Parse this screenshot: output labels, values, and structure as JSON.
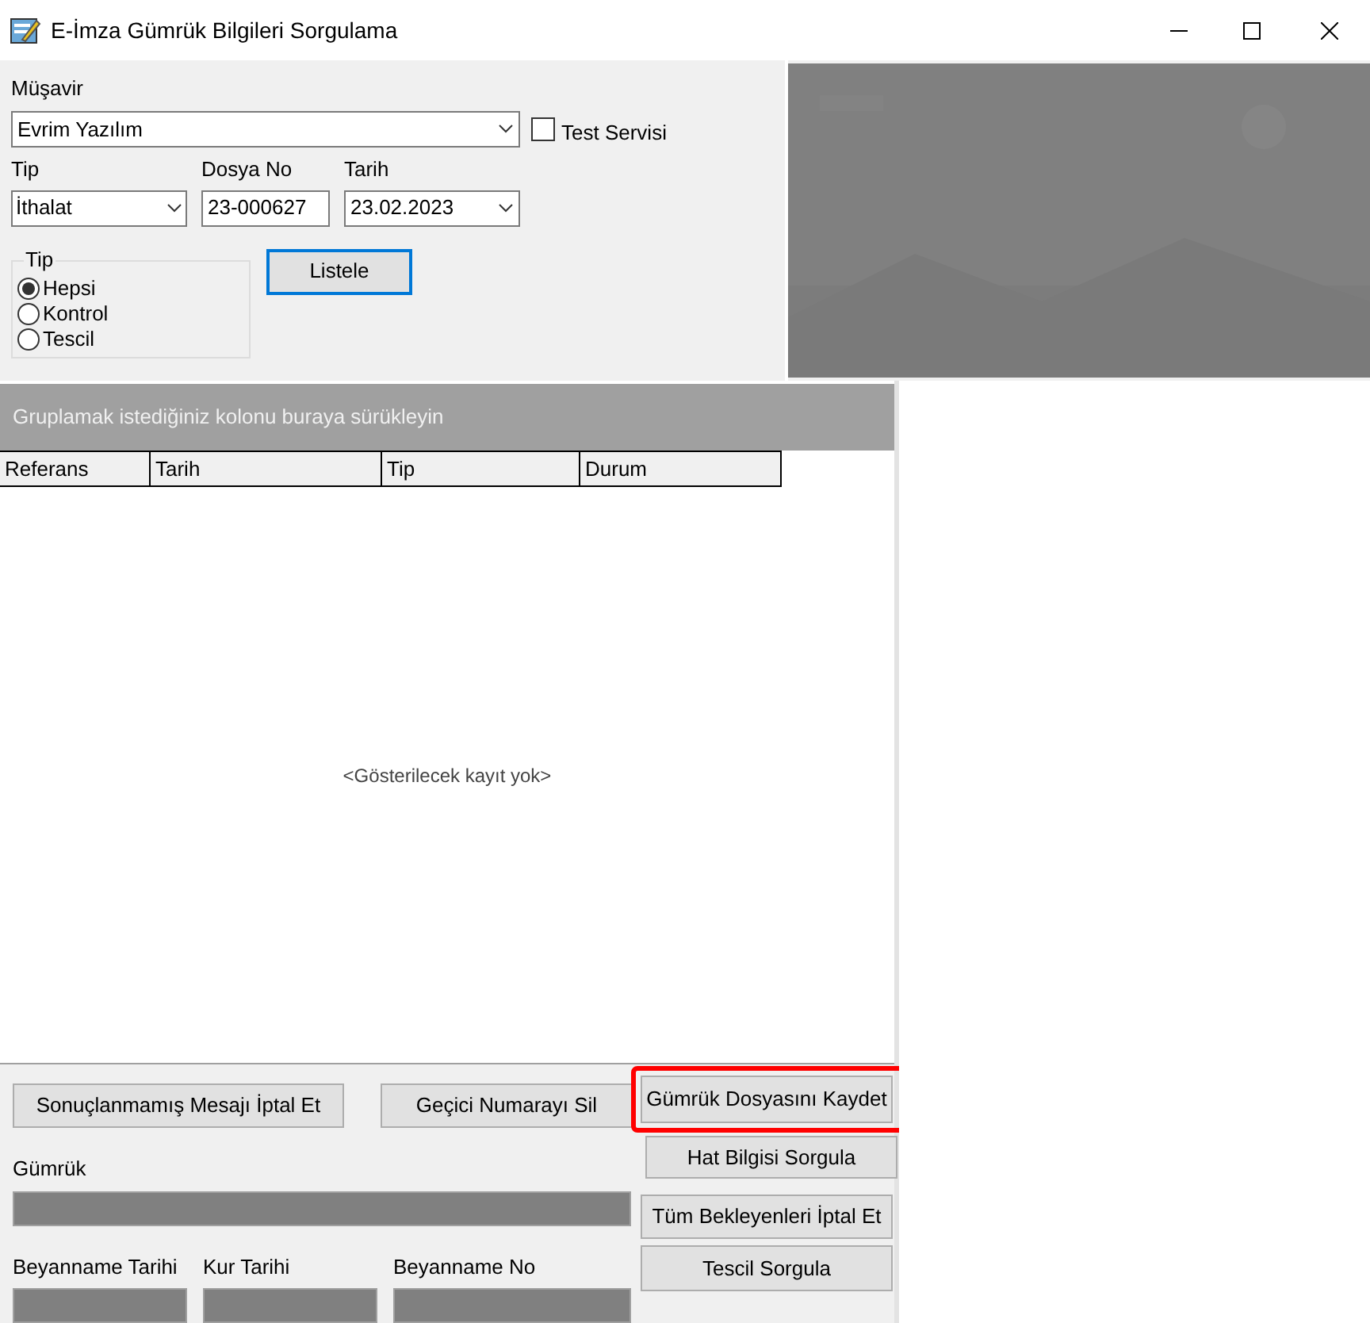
{
  "window": {
    "title": "E-İmza Gümrük Bilgileri Sorgulama"
  },
  "form": {
    "musavir": {
      "label": "Müşavir",
      "value": "Evrim Yazılım"
    },
    "test_servisi": {
      "label": "Test Servisi",
      "checked": false
    },
    "tip": {
      "label": "Tip",
      "value": "İthalat"
    },
    "dosya_no": {
      "label": "Dosya No",
      "value": "23-000627"
    },
    "tarih": {
      "label": "Tarih",
      "value": "23.02.2023"
    },
    "radio_group": {
      "label": "Tip",
      "options": [
        {
          "label": "Hepsi",
          "selected": true
        },
        {
          "label": "Kontrol",
          "selected": false
        },
        {
          "label": "Tescil",
          "selected": false
        }
      ]
    },
    "list_button": {
      "label": "Listele",
      "focused": true
    }
  },
  "grid": {
    "group_panel": "Gruplamak istediğiniz kolonu buraya sürükleyin",
    "columns": [
      "Referans",
      "Tarih",
      "Tip",
      "Durum"
    ],
    "empty_text": "<Gösterilecek kayıt yok>"
  },
  "bottom": {
    "buttons": [
      {
        "label": "Sonuçlanmamış Mesajı İptal Et",
        "highlighted": false
      },
      {
        "label": "Geçici Numarayı Sil",
        "highlighted": false
      },
      {
        "label": "Gümrük Dosyasını Kaydet",
        "highlighted": true
      },
      {
        "label": "Hat Bilgisi Sorgula",
        "highlighted": false
      },
      {
        "label": "Tüm Bekleyenleri İptal Et",
        "highlighted": false
      },
      {
        "label": "Tescil Sorgula",
        "highlighted": false
      }
    ],
    "fields": [
      {
        "label": "Gümrük"
      },
      {
        "label": "Beyanname Tarihi"
      },
      {
        "label": "Kur Tarihi"
      },
      {
        "label": "Beyanname No"
      }
    ]
  }
}
